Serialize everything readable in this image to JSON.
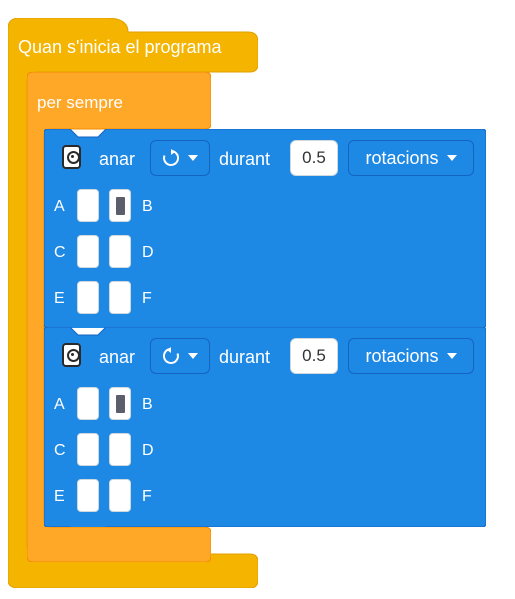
{
  "hat_block": {
    "label": "Quan s'inicia el programa",
    "color": "#f4b400"
  },
  "forever_block": {
    "label": "per sempre",
    "color": "#ffa726"
  },
  "motor_blocks": [
    {
      "icon": "motor-icon",
      "action": "anar",
      "direction": {
        "icon": "rotate-clockwise-icon"
      },
      "during_label": "durant",
      "value": "0.5",
      "unit": "rotacions",
      "ports": [
        {
          "label": "A",
          "selected": false
        },
        {
          "label": "B",
          "selected": true
        },
        {
          "label": "C",
          "selected": false
        },
        {
          "label": "D",
          "selected": false
        },
        {
          "label": "E",
          "selected": false
        },
        {
          "label": "F",
          "selected": false
        }
      ]
    },
    {
      "icon": "motor-icon",
      "action": "anar",
      "direction": {
        "icon": "rotate-counterclockwise-icon"
      },
      "during_label": "durant",
      "value": "0.5",
      "unit": "rotacions",
      "ports": [
        {
          "label": "A",
          "selected": false
        },
        {
          "label": "B",
          "selected": true
        },
        {
          "label": "C",
          "selected": false
        },
        {
          "label": "D",
          "selected": false
        },
        {
          "label": "E",
          "selected": false
        },
        {
          "label": "F",
          "selected": false
        }
      ]
    }
  ],
  "colors": {
    "motor_block": "#1e88e5",
    "motor_border": "#1565c0"
  }
}
